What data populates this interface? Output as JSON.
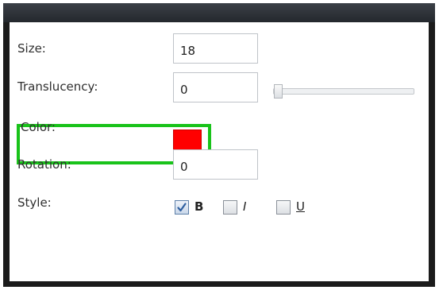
{
  "properties": {
    "size": {
      "label": "Size:",
      "value": "18"
    },
    "translucency": {
      "label": "Translucency:",
      "value": "0",
      "slider_level": 0
    },
    "color": {
      "label": "Color:",
      "swatch": "#ff0000"
    },
    "rotation": {
      "label": "Rotation:",
      "value": "0"
    },
    "style": {
      "label": "Style:",
      "options": [
        {
          "text": "B",
          "checked": true
        },
        {
          "text": "I",
          "checked": false
        },
        {
          "text": "U",
          "checked": false
        }
      ]
    }
  },
  "colors": {
    "highlight": "#19c31a",
    "title_bar": "#2b3036"
  }
}
